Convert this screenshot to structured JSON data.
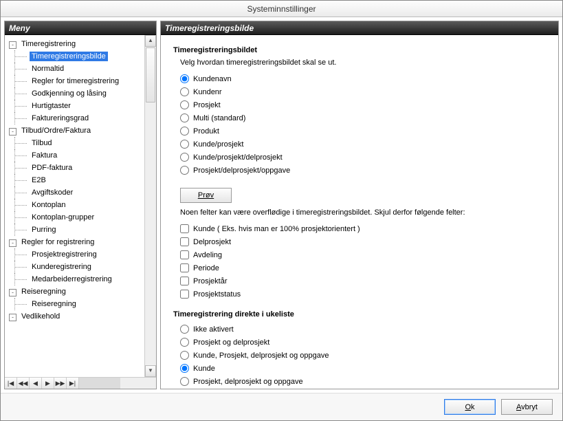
{
  "window": {
    "title": "Systeminnstillinger"
  },
  "left": {
    "header": "Meny",
    "tree": [
      {
        "lvl": 1,
        "toggle": "-",
        "label": "Timeregistrering",
        "name": "tree-timeregistrering"
      },
      {
        "lvl": 2,
        "label": "Timeregistreringsbilde",
        "selected": true,
        "name": "tree-timeregistreringsbilde"
      },
      {
        "lvl": 2,
        "label": "Normaltid",
        "name": "tree-normaltid"
      },
      {
        "lvl": 2,
        "label": "Regler for timeregistrering",
        "name": "tree-regler-for-timeregistrering"
      },
      {
        "lvl": 2,
        "label": "Godkjenning og låsing",
        "name": "tree-godkjenning-og-lasing"
      },
      {
        "lvl": 2,
        "label": "Hurtigtaster",
        "name": "tree-hurtigtaster"
      },
      {
        "lvl": 2,
        "label": "Faktureringsgrad",
        "name": "tree-faktureringsgrad"
      },
      {
        "lvl": 1,
        "toggle": "-",
        "label": "Tilbud/Ordre/Faktura",
        "name": "tree-tilbud-ordre-faktura"
      },
      {
        "lvl": 2,
        "label": "Tilbud",
        "name": "tree-tilbud"
      },
      {
        "lvl": 2,
        "label": "Faktura",
        "name": "tree-faktura"
      },
      {
        "lvl": 2,
        "label": "PDF-faktura",
        "name": "tree-pdf-faktura"
      },
      {
        "lvl": 2,
        "label": "E2B",
        "name": "tree-e2b"
      },
      {
        "lvl": 2,
        "label": "Avgiftskoder",
        "name": "tree-avgiftskoder"
      },
      {
        "lvl": 2,
        "label": "Kontoplan",
        "name": "tree-kontoplan"
      },
      {
        "lvl": 2,
        "label": "Kontoplan-grupper",
        "name": "tree-kontoplan-grupper"
      },
      {
        "lvl": 2,
        "label": "Purring",
        "name": "tree-purring"
      },
      {
        "lvl": 1,
        "toggle": "-",
        "label": "Regler for registrering",
        "name": "tree-regler-for-registrering"
      },
      {
        "lvl": 2,
        "label": "Prosjektregistrering",
        "name": "tree-prosjektregistrering"
      },
      {
        "lvl": 2,
        "label": "Kunderegistrering",
        "name": "tree-kunderegistrering"
      },
      {
        "lvl": 2,
        "label": "Medarbeiderregistrering",
        "name": "tree-medarbeiderregistrering"
      },
      {
        "lvl": 1,
        "toggle": "-",
        "label": "Reiseregning",
        "name": "tree-reiseregning"
      },
      {
        "lvl": 2,
        "label": "Reiseregning",
        "name": "tree-reiseregning-sub"
      },
      {
        "lvl": 1,
        "toggle": "-",
        "label": "Vedlikehold",
        "name": "tree-vedlikehold"
      }
    ],
    "nav": [
      "|◀",
      "◀◀",
      "◀",
      "▶",
      "▶▶",
      "▶|"
    ]
  },
  "right": {
    "header": "Timeregistreringsbilde",
    "section1_title": "Timeregistreringsbildet",
    "section1_sub": "Velg hvordan timeregistreringsbildet skal se ut.",
    "radios1": [
      {
        "label": "Kundenavn",
        "checked": true
      },
      {
        "label": "Kundenr"
      },
      {
        "label": "Prosjekt"
      },
      {
        "label": "Multi (standard)"
      },
      {
        "label": "Produkt"
      },
      {
        "label": "Kunde/prosjekt"
      },
      {
        "label": "Kunde/prosjekt/delprosjekt"
      },
      {
        "label": "Prosjekt/delprosjekt/oppgave"
      }
    ],
    "try_label": "Prøv",
    "hint": "Noen felter kan være overflødige i timeregistreringsbildet. Skjul derfor følgende felter:",
    "checks": [
      {
        "label": "Kunde ( Eks. hvis man er 100% prosjektorientert )"
      },
      {
        "label": "Delprosjekt"
      },
      {
        "label": "Avdeling"
      },
      {
        "label": "Periode"
      },
      {
        "label": "Prosjektår"
      },
      {
        "label": "Prosjektstatus"
      }
    ],
    "section2_title": "Timeregistrering direkte i ukeliste",
    "radios2": [
      {
        "label": "Ikke aktivert"
      },
      {
        "label": "Prosjekt og delprosjekt"
      },
      {
        "label": "Kunde, Prosjekt, delprosjekt og oppgave"
      },
      {
        "label": "Kunde",
        "checked": true
      },
      {
        "label": "Prosjekt, delprosjekt og oppgave"
      }
    ]
  },
  "footer": {
    "ok": "Ok",
    "cancel": "Avbryt",
    "ok_u": "O",
    "ok_rest": "k",
    "cancel_u": "A",
    "cancel_rest": "vbryt"
  }
}
